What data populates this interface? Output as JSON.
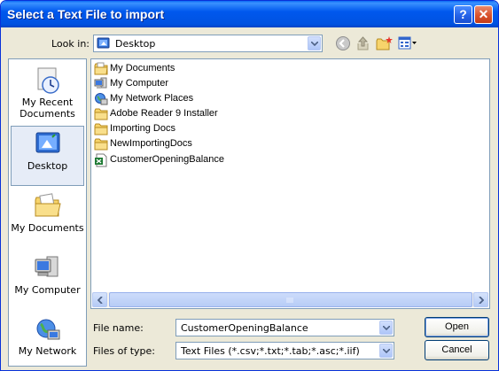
{
  "window": {
    "title": "Select a Text File to import"
  },
  "titlebar": {
    "help": "?",
    "close": "✕"
  },
  "look_in": {
    "label": "Look in:",
    "value": "Desktop"
  },
  "places": [
    {
      "label": "My Recent Documents",
      "icon": "recent-documents-icon"
    },
    {
      "label": "Desktop",
      "icon": "desktop-icon"
    },
    {
      "label": "My Documents",
      "icon": "my-documents-icon"
    },
    {
      "label": "My Computer",
      "icon": "my-computer-icon"
    },
    {
      "label": "My Network",
      "icon": "my-network-icon"
    }
  ],
  "files": [
    {
      "name": "My Documents",
      "icon": "my-documents-icon"
    },
    {
      "name": "My Computer",
      "icon": "my-computer-icon"
    },
    {
      "name": "My Network Places",
      "icon": "network-places-icon"
    },
    {
      "name": "Adobe Reader 9 Installer",
      "icon": "folder-icon"
    },
    {
      "name": "Importing Docs",
      "icon": "folder-icon"
    },
    {
      "name": "NewImportingDocs",
      "icon": "folder-icon"
    },
    {
      "name": "CustomerOpeningBalance",
      "icon": "excel-file-icon"
    }
  ],
  "file_name": {
    "label": "File name:",
    "value": "CustomerOpeningBalance"
  },
  "file_type": {
    "label": "Files of type:",
    "value": "Text Files (*.csv;*.txt;*.tab;*.asc;*.iif)"
  },
  "buttons": {
    "open": "Open",
    "cancel": "Cancel"
  },
  "colors": {
    "titlebar": "#0055E5",
    "dialog_bg": "#ECE9D8",
    "border": "#7F9DB9"
  }
}
